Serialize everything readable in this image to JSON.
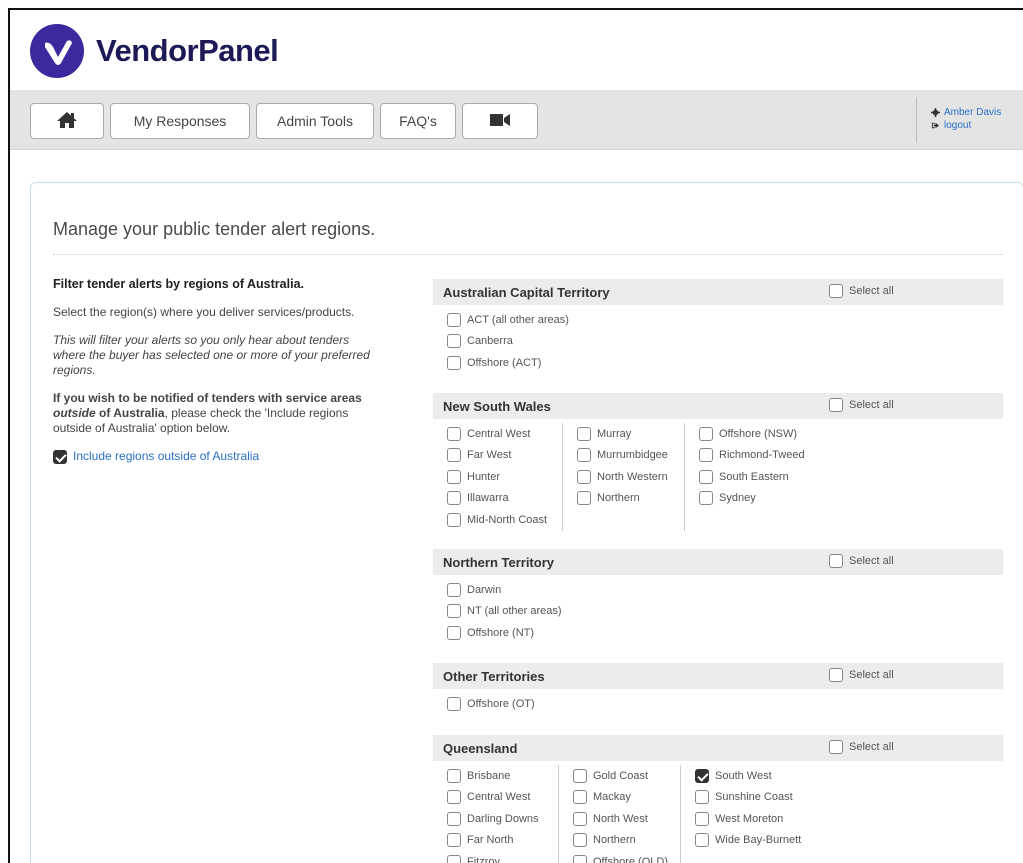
{
  "brand": {
    "name": "VendorPanel"
  },
  "nav": {
    "home_icon": "home-icon",
    "buttons": [
      "My Responses",
      "Admin Tools",
      "FAQ's"
    ],
    "video_icon": "video-camera-icon"
  },
  "user": {
    "name": "Amber Davis",
    "logout": "logout"
  },
  "page": {
    "title": "Manage your public tender alert regions.",
    "filter_heading": "Filter tender alerts by regions of Australia.",
    "select_text": "Select the region(s) where you deliver services/products.",
    "italic_text": "This will filter your alerts so you only hear about tenders where the buyer has selected one or more of your preferred regions.",
    "outside_bold_1": "If you wish to be notified of tenders with service areas ",
    "outside_italic": "outside",
    "outside_bold_2": " of Australia",
    "outside_rest": ", please check the 'Include regions outside of Australia' option below.",
    "include_label": "Include regions outside of Australia",
    "include_checked": true
  },
  "select_all_label": "Select all",
  "sections": [
    {
      "title": "Australian Capital Territory",
      "columns": [
        [
          "ACT (all other areas)",
          "Canberra",
          "Offshore (ACT)"
        ]
      ]
    },
    {
      "title": "New South Wales",
      "columns": [
        [
          "Central West",
          "Far West",
          "Hunter",
          "Illawarra",
          "Mid-North Coast"
        ],
        [
          "Murray",
          "Murrumbidgee",
          "North Western",
          "Northern"
        ],
        [
          "Offshore (NSW)",
          "Richmond-Tweed",
          "South Eastern",
          "Sydney"
        ]
      ]
    },
    {
      "title": "Northern Territory",
      "columns": [
        [
          "Darwin",
          "NT (all other areas)",
          "Offshore (NT)"
        ]
      ]
    },
    {
      "title": "Other Territories",
      "columns": [
        [
          "Offshore (OT)"
        ]
      ]
    },
    {
      "title": "Queensland",
      "columns": [
        [
          "Brisbane",
          "Central West",
          "Darling Downs",
          "Far North",
          "Fitzroy"
        ],
        [
          "Gold Coast",
          "Mackay",
          "North West",
          "Northern",
          "Offshore (QLD)"
        ],
        [
          "South West",
          "Sunshine Coast",
          "West Moreton",
          "Wide Bay-Burnett"
        ]
      ],
      "checked": [
        "South West"
      ]
    }
  ]
}
